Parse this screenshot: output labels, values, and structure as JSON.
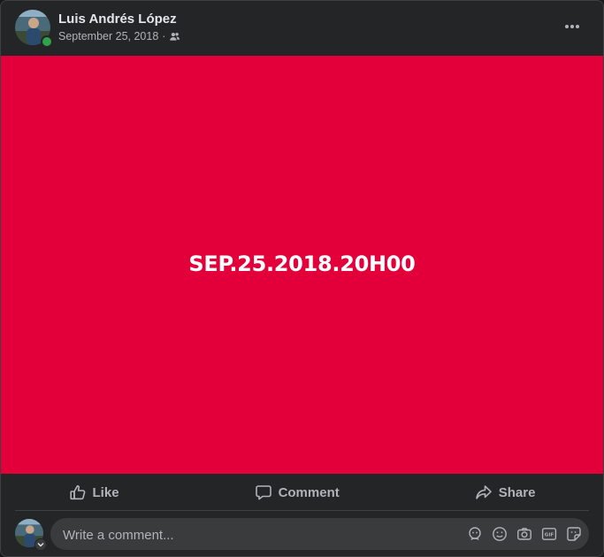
{
  "post": {
    "author": "Luis Andrés López",
    "date": "September 25, 2018",
    "separator": "·",
    "audience_icon": "friends-icon",
    "image_text": "SEP.25.2018.20H00",
    "image_background": "#e3003a"
  },
  "actions": {
    "like_label": "Like",
    "comment_label": "Comment",
    "share_label": "Share"
  },
  "comment": {
    "placeholder": "Write a comment..."
  },
  "icons": {
    "more": "more-horizontal-icon",
    "like": "thumbs-up-icon",
    "comment": "speech-bubble-icon",
    "share": "share-arrow-icon",
    "avatar_sticker": "avatar-sticker-icon",
    "emoji": "emoji-icon",
    "camera": "camera-icon",
    "gif": "gif-icon",
    "sticker": "sticker-icon"
  },
  "colors": {
    "background": "#242526",
    "text_primary": "#e4e6eb",
    "text_secondary": "#b0b3b8",
    "online": "#31a24c"
  }
}
